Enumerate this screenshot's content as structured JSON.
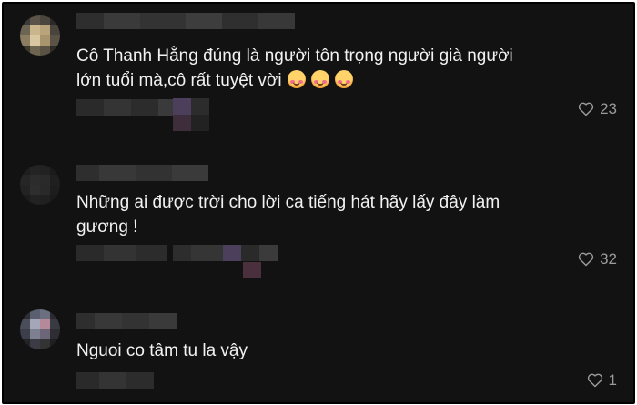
{
  "comments": [
    {
      "text_line1": "Cô Thanh Hằng đúng là người tôn trọng người già người",
      "text_line2": "lớn tuổi mà,cô rất tuyệt vời",
      "emojis": [
        "smiling-face-with-hearts",
        "smiling-face-with-hearts",
        "smiling-face-with-hearts"
      ],
      "likes": "23"
    },
    {
      "text_line1": "Những ai được trời cho lời ca tiếng hát hãy lấy đây làm",
      "text_line2": "gương !",
      "likes": "32"
    },
    {
      "text_line1": "Nguoi co tâm tu la vậy",
      "likes": "1"
    }
  ],
  "colors": {
    "background": "#121212",
    "text": "#f2f2f2",
    "muted": "#9b9b9b"
  },
  "icons": {
    "like": "heart-outline-icon",
    "avatar": "blurred-avatar"
  }
}
